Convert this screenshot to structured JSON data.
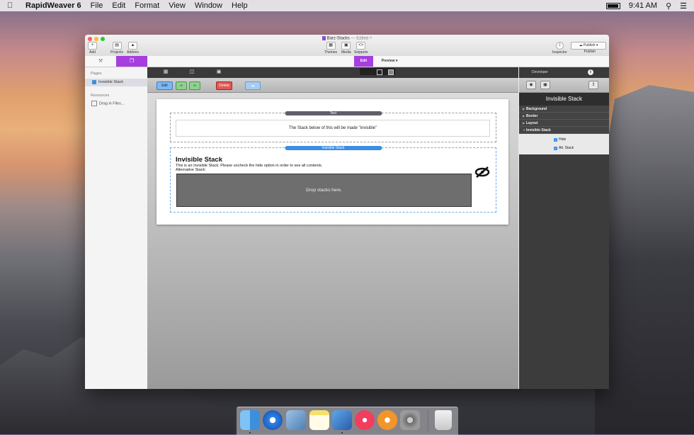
{
  "menubar": {
    "app_name": "RapidWeaver 6",
    "items": [
      "File",
      "Edit",
      "Format",
      "View",
      "Window",
      "Help"
    ],
    "clock": "9:41 AM"
  },
  "window": {
    "title": "Barz-Stacks",
    "title_status": "— Edited ˅",
    "toolbar": {
      "add": "Add",
      "projects": "Projects",
      "addons": "Addons",
      "themes": "Themes",
      "media": "Media",
      "snippets": "Snippets",
      "inspector": "Inspector",
      "publish_button": "Publish",
      "publish_label": "Publish"
    },
    "tabs": {
      "edit": "Edit",
      "preview": "Preview"
    }
  },
  "sidebar": {
    "pages_heading": "Pages",
    "page_item": "Invisible Stack",
    "resources_heading": "Resources",
    "resources_item": "Drag in Files..."
  },
  "editor": {
    "toolbar": {
      "edit": "Edit",
      "delete": "Delete"
    },
    "text_stack": {
      "tag": "Text",
      "content": "The Stack below of this will be made \"invisible\""
    },
    "invisible_stack": {
      "tag": "Invisible Stack",
      "title": "Invisible Stack",
      "description": "This is an Invisible Stack. Please uncheck the hide option in order to see all contents.",
      "alt_label": "Alternative Stack:",
      "drop_text": "Drop stacks here."
    }
  },
  "inspector": {
    "header": "Developer",
    "title": "Invisible Stack",
    "sections": [
      "Background",
      "Border",
      "Layout",
      "Invisible Stack"
    ],
    "options": [
      {
        "label": "Hide",
        "checked": true
      },
      {
        "label": "Alt. Stack",
        "checked": true
      }
    ]
  },
  "colors": {
    "accent": "#a63ee0",
    "stack_blue": "#3a8ee6",
    "delete_red": "#d9413a"
  }
}
